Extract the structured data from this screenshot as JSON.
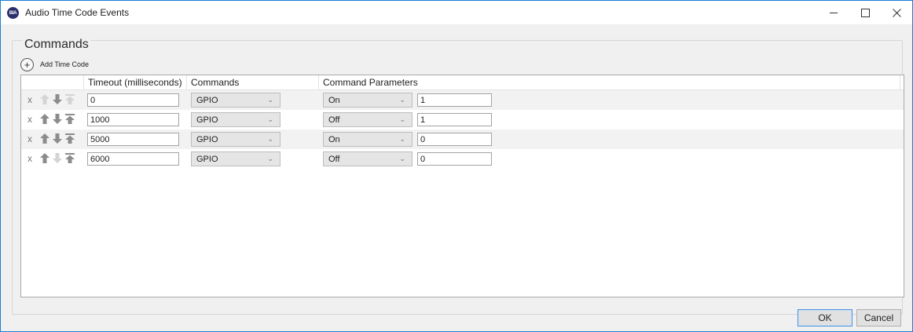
{
  "window": {
    "title": "Audio Time Code Events",
    "logo_text": "BIA",
    "controls": [
      "minimize",
      "maximize",
      "close"
    ]
  },
  "group": {
    "title": "Commands",
    "add_label": "Add Time Code",
    "add_icon": "+"
  },
  "grid": {
    "headers": {
      "timeout": "Timeout (milliseconds)",
      "commands": "Commands",
      "params": "Command Parameters"
    },
    "delete_glyph": "x",
    "chevron_glyph": "⌄",
    "rows": [
      {
        "timeout": "0",
        "command": "GPIO",
        "param1": "On",
        "param2": "1",
        "up_enabled": false,
        "down_enabled": true,
        "top_enabled": false
      },
      {
        "timeout": "1000",
        "command": "GPIO",
        "param1": "Off",
        "param2": "1",
        "up_enabled": true,
        "down_enabled": true,
        "top_enabled": true
      },
      {
        "timeout": "5000",
        "command": "GPIO",
        "param1": "On",
        "param2": "0",
        "up_enabled": true,
        "down_enabled": true,
        "top_enabled": true
      },
      {
        "timeout": "6000",
        "command": "GPIO",
        "param1": "Off",
        "param2": "0",
        "up_enabled": true,
        "down_enabled": false,
        "top_enabled": true
      }
    ]
  },
  "footer": {
    "ok_label": "OK",
    "cancel_label": "Cancel"
  },
  "colors": {
    "window_border": "#1a7fd4",
    "arrow_enabled": "#8c8c8c",
    "arrow_disabled": "#d4d4d4"
  }
}
